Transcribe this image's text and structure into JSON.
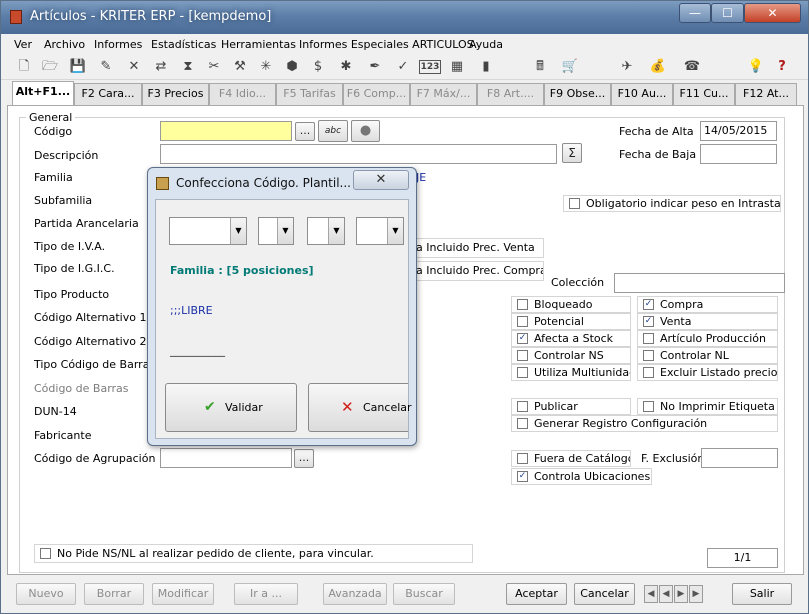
{
  "window": {
    "title": "Artículos - KRITER ERP - [kempdemo]",
    "minimize_glyph": "—",
    "maximize_glyph": "☐",
    "close_glyph": "✕"
  },
  "menu": [
    "Ver",
    "Archivo",
    "Informes",
    "Estadísticas",
    "Herramientas",
    "Informes Especiales ARTICULOS",
    "Ayuda"
  ],
  "toolbar_glyphs": [
    "🗋",
    "🗁",
    "💾",
    "✎",
    "✕",
    "⇄",
    "⧗",
    "✂",
    "⚒",
    "✳",
    "⬢",
    "$",
    "✱",
    "✒",
    "✓",
    "123",
    "▦",
    "▮",
    "🖩",
    "🛒",
    "✈",
    "💰",
    "☎",
    "💡",
    "?"
  ],
  "tabs": [
    {
      "label": "Alt+F1...",
      "state": "active"
    },
    {
      "label": "F2 Cara...",
      "state": "enabled"
    },
    {
      "label": "F3 Precios",
      "state": "enabled"
    },
    {
      "label": "F4 Idio...",
      "state": "disabled"
    },
    {
      "label": "F5 Tarifas",
      "state": "disabled"
    },
    {
      "label": "F6 Comp...",
      "state": "disabled"
    },
    {
      "label": "F7 Máx/...",
      "state": "disabled"
    },
    {
      "label": "F8 Art....",
      "state": "disabled"
    },
    {
      "label": "F9 Obse...",
      "state": "enabled"
    },
    {
      "label": "F10 Au...",
      "state": "enabled"
    },
    {
      "label": "F11 Cu...",
      "state": "enabled"
    },
    {
      "label": "F12 At...",
      "state": "enabled"
    }
  ],
  "form": {
    "group_label": "General",
    "labels": {
      "codigo": "Código",
      "descripcion": "Descripción",
      "familia": "Familia",
      "subfamilia": "Subfamilia",
      "partida": "Partida Arancelaria",
      "tipo_iva": "Tipo de I.V.A.",
      "tipo_igic": "Tipo de I.G.I.C.",
      "tipo_producto": "Tipo Producto",
      "cod_alt1": "Código Alternativo 1",
      "cod_alt2": "Código Alternativo 2",
      "tipo_cod_barras": "Tipo Código de Barras",
      "cod_barras": "Código de Barras",
      "dun14": "DUN-14",
      "fabricante": "Fabricante",
      "cod_agrupacion": "Código de Agrupación",
      "fecha_alta": "Fecha de Alta",
      "fecha_baja": "Fecha de Baja",
      "coleccion": "Colección",
      "f_exclusion": "F. Exclusión"
    },
    "values": {
      "codigo": "",
      "descripcion": "",
      "fecha_alta": "14/05/2015",
      "fecha_baja": "",
      "familia_partial": "JE",
      "iva_incluido": "a Incluido Prec. Venta",
      "igic_incluido": "a Incluido Prec. Compra"
    },
    "codigo_buttons": {
      "ellipsis": "...",
      "abc": "abc",
      "circle": "●"
    },
    "sigma": "Σ",
    "ellipsis": "..."
  },
  "checkboxes": {
    "obligatorio": {
      "label": "Obligatorio indicar peso en Intrastat",
      "checked": false
    },
    "bloqueado": {
      "label": "Bloqueado",
      "checked": false
    },
    "compra": {
      "label": "Compra",
      "checked": true
    },
    "potencial": {
      "label": "Potencial",
      "checked": false
    },
    "venta": {
      "label": "Venta",
      "checked": true
    },
    "afecta_stock": {
      "label": "Afecta a Stock",
      "checked": true
    },
    "art_produccion": {
      "label": "Artículo Producción",
      "checked": false
    },
    "controlar_ns": {
      "label": "Controlar NS",
      "checked": false
    },
    "controlar_nl": {
      "label": "Controlar NL",
      "checked": false
    },
    "multiunidad": {
      "label": "Utiliza Multiunidad",
      "checked": false
    },
    "excluir_listado": {
      "label": "Excluir Listado precio n",
      "checked": false
    },
    "publicar": {
      "label": "Publicar",
      "checked": false
    },
    "no_imprimir": {
      "label": "No Imprimir Etiqueta",
      "checked": false
    },
    "generar_registro": {
      "label": "Generar Registro Configuración",
      "checked": false
    },
    "fuera_catalogo": {
      "label": "Fuera de Catálogo",
      "checked": false
    },
    "controla_ubic": {
      "label": "Controla Ubicaciones",
      "checked": true
    },
    "no_pide_ns": {
      "label": "No Pide NS/NL al realizar pedido de cliente, para vincular.",
      "checked": false
    }
  },
  "pager": "1/1",
  "check_mark": "✓",
  "bottom": {
    "nuevo": "Nuevo",
    "borrar": "Borrar",
    "modificar": "Modificar",
    "ira": "Ir a ...",
    "avanzada": "Avanzada",
    "buscar": "Buscar",
    "aceptar": "Aceptar",
    "cancelar": "Cancelar",
    "salir": "Salir"
  },
  "dialog": {
    "title": "Confecciona Código. Plantil...",
    "close_glyph": "✕",
    "familia_info": "Familia  : [5 posiciones]",
    "libre": ";;;LIBRE",
    "placeholder_line": "__________",
    "combo_arrow": "▼",
    "validar": "Validar",
    "validar_icon": "✔",
    "cancelar": "Cancelar",
    "cancelar_icon": "✕"
  },
  "colors": {
    "familia_text": "#007a75",
    "libre_text": "#1a2fa8",
    "validar_icon": "#3aa02e",
    "cancelar_icon": "#d0221b"
  }
}
